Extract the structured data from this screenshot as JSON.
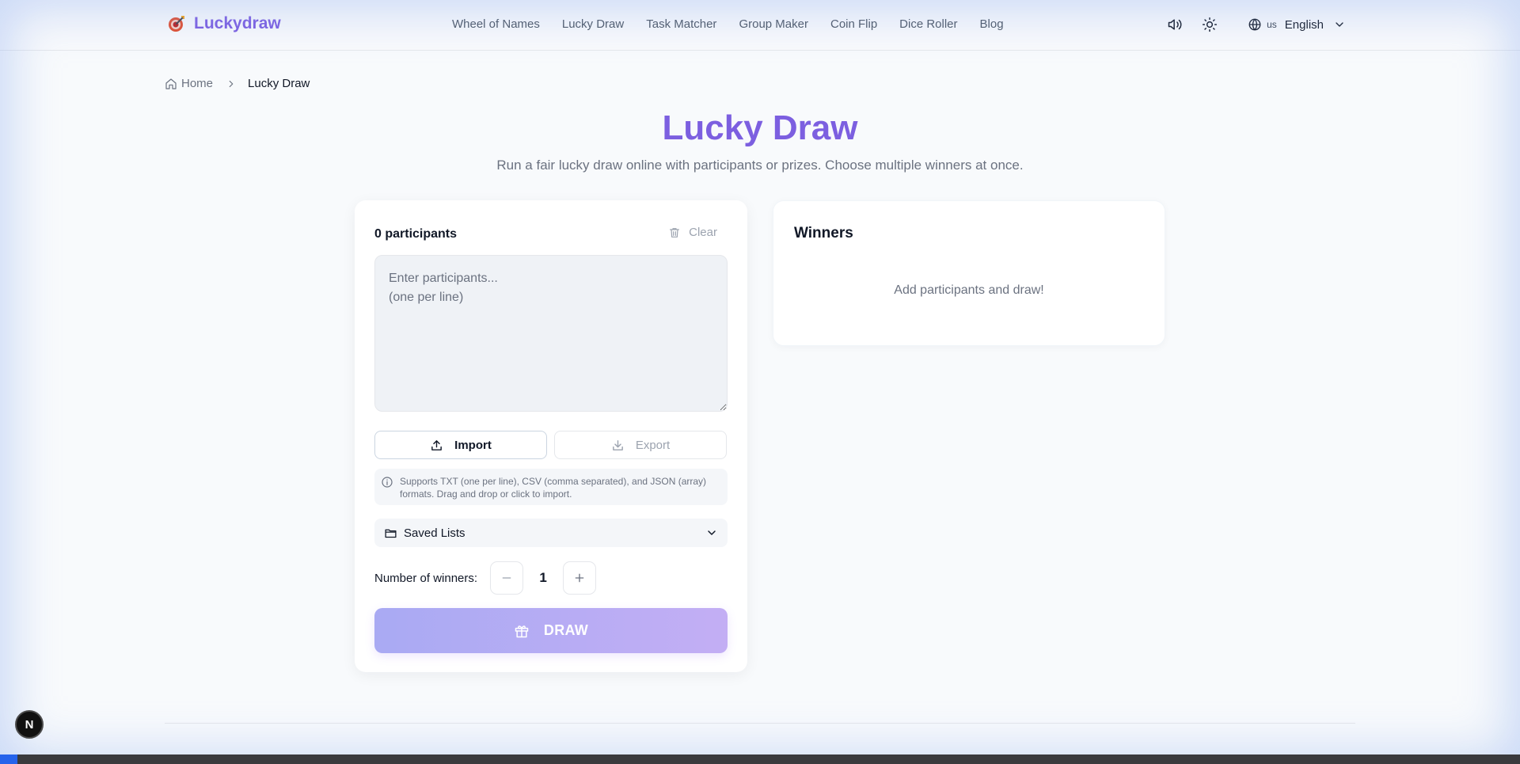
{
  "header": {
    "brand": "Luckydraw",
    "nav": [
      "Wheel of Names",
      "Lucky Draw",
      "Task Matcher",
      "Group Maker",
      "Coin Flip",
      "Dice Roller",
      "Blog"
    ],
    "language_code": "us",
    "language": "English"
  },
  "breadcrumb": {
    "home": "Home",
    "current": "Lucky Draw"
  },
  "page": {
    "title": "Lucky Draw",
    "subtitle": "Run a fair lucky draw online with participants or prizes. Choose multiple winners at once."
  },
  "participants": {
    "count_label": "0 participants",
    "clear_label": "Clear",
    "placeholder": "Enter participants...\n(one per line)",
    "value": "",
    "import_label": "Import",
    "export_label": "Export",
    "info_text": "Supports TXT (one per line), CSV (comma separated), and JSON (array) formats. Drag and drop or click to import.",
    "saved_lists_label": "Saved Lists",
    "winners_label": "Number of winners:",
    "winners_value": "1",
    "draw_label": "DRAW"
  },
  "winners": {
    "title": "Winners",
    "empty_text": "Add participants and draw!"
  },
  "badge": {
    "letter": "N"
  },
  "colors": {
    "brand": "#7a5ce0",
    "draw_gradient_start": "#a9aaf3",
    "draw_gradient_end": "#c3aef4"
  },
  "icons": [
    "logo-icon",
    "volume-icon",
    "sun-icon",
    "globe-icon",
    "chevron-down-icon",
    "home-icon",
    "chevron-right-icon",
    "trash-icon",
    "upload-icon",
    "download-icon",
    "info-icon",
    "folder-icon",
    "minus-icon",
    "plus-icon",
    "gift-icon"
  ]
}
